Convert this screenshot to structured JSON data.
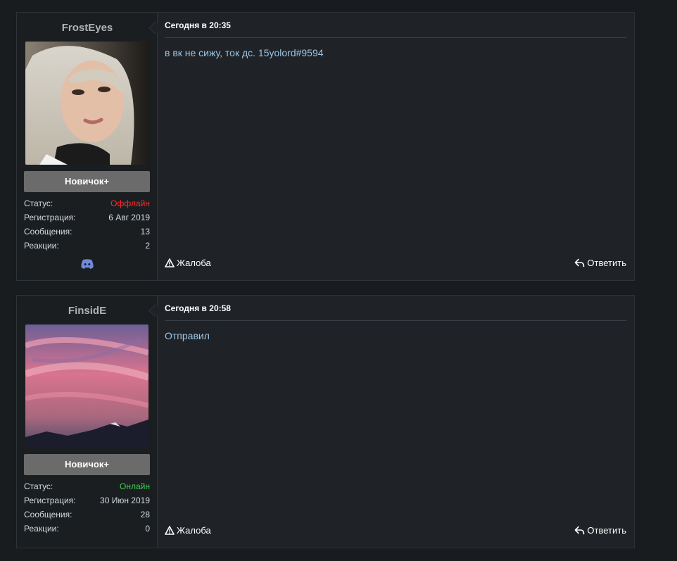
{
  "posts": [
    {
      "username": "FrostEyes",
      "rank": "Новичок+",
      "stats": {
        "status_label": "Статус:",
        "status_value": "Оффлайн",
        "reg_label": "Регистрация:",
        "reg_value": "6 Авг 2019",
        "messages_label": "Сообщения:",
        "messages_value": "13",
        "reactions_label": "Реакции:",
        "reactions_value": "2"
      },
      "time": "Сегодня в 20:35",
      "body": "в вк не сижу, ток дс. 15yolord#9594",
      "report_label": "Жалоба",
      "reply_label": "Ответить"
    },
    {
      "username": "FinsidE",
      "rank": "Новичок+",
      "stats": {
        "status_label": "Статус:",
        "status_value": "Онлайн",
        "reg_label": "Регистрация:",
        "reg_value": "30 Июн 2019",
        "messages_label": "Сообщения:",
        "messages_value": "28",
        "reactions_label": "Реакции:",
        "reactions_value": "0"
      },
      "time": "Сегодня в 20:58",
      "body": "Отправил",
      "report_label": "Жалоба",
      "reply_label": "Ответить"
    }
  ],
  "colors": {
    "offline": "#ff2a2a",
    "online": "#3fd14f",
    "message_text": "#9ec4e4",
    "rank_bg": "#6b6b6b",
    "discord": "#7289da"
  },
  "icons": {
    "report": "warning-triangle-icon",
    "reply": "reply-arrow-icon",
    "contact": "discord-icon"
  }
}
